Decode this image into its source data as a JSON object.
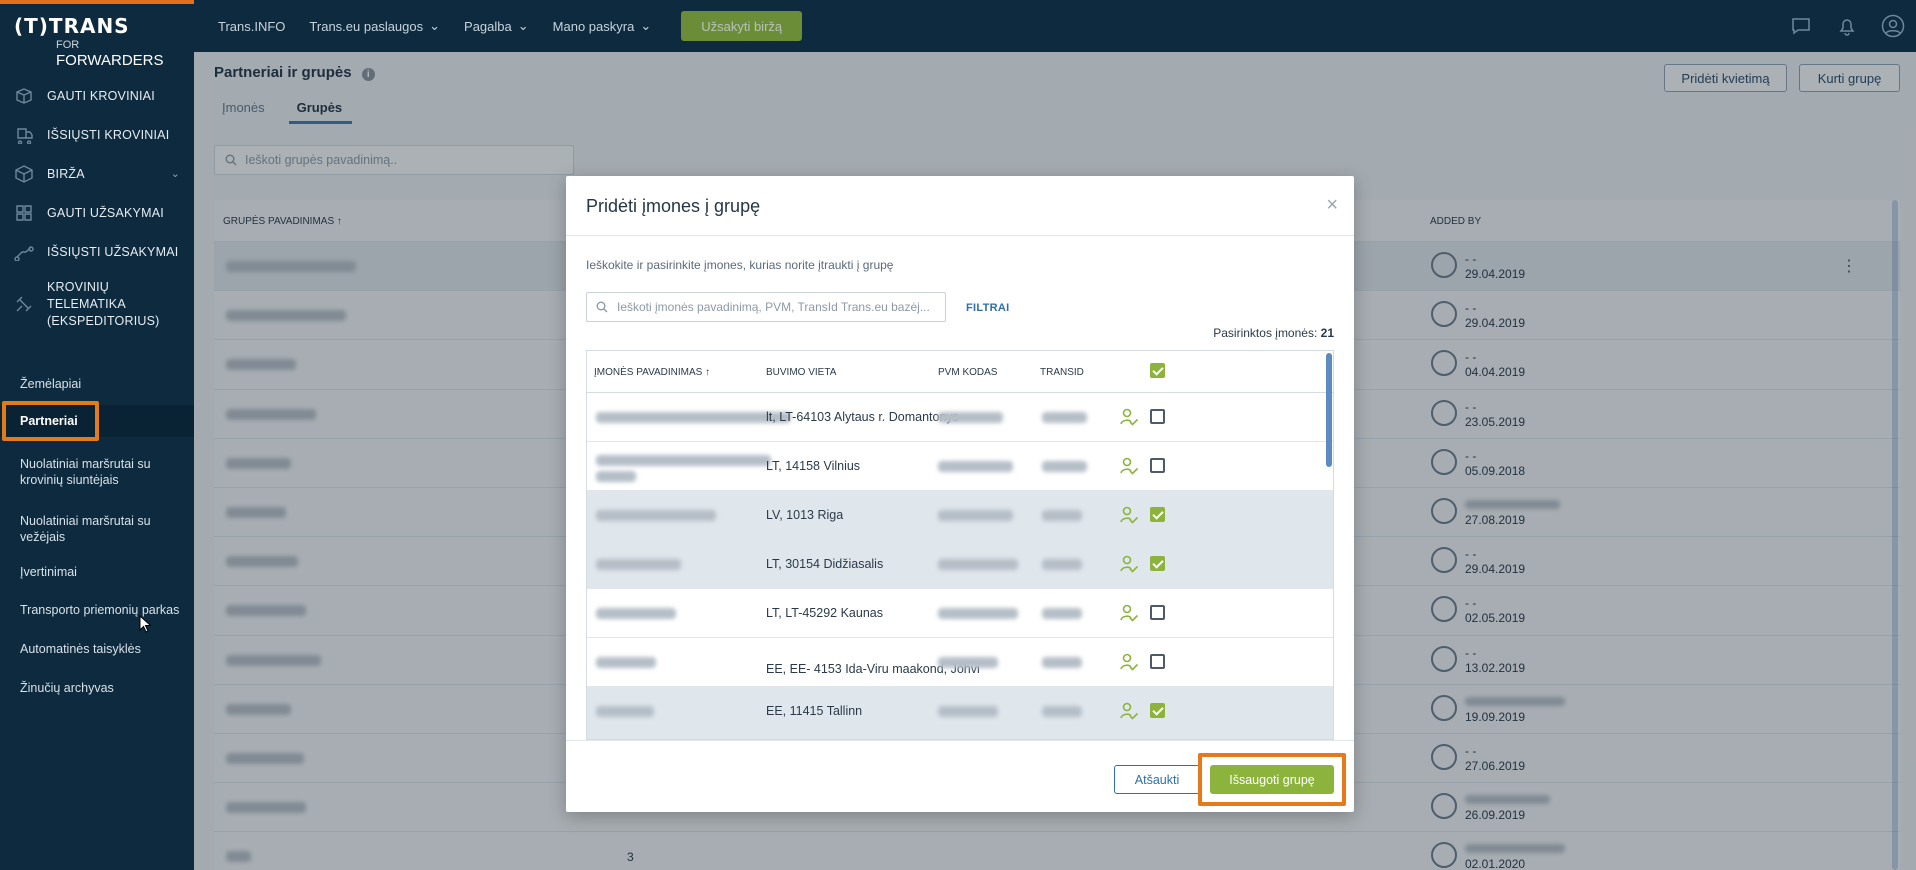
{
  "logo": {
    "line1": "(T)TRANS",
    "line2_small": "FOR",
    "line2": "FORWARDERS"
  },
  "sidebar": {
    "nav": [
      {
        "label": "GAUTI KROVINIAI",
        "icon": "box-icon"
      },
      {
        "label": "IŠSIŲSTI KROVINIAI",
        "icon": "box-send-icon"
      },
      {
        "label": "BIRŽA",
        "icon": "cube-icon",
        "expandable": true
      },
      {
        "label": "GAUTI UŽSAKYMAI",
        "icon": "grid-icon"
      },
      {
        "label": "IŠSIŲSTI UŽSAKYMAI",
        "icon": "link-icon"
      },
      {
        "label": "KROVINIŲ TELEMATIKA (EKSPEDITORIUS)",
        "icon": "satellite-icon"
      }
    ],
    "sub": [
      {
        "label": "Žemėlapiai"
      },
      {
        "label": "Partneriai",
        "active": true
      },
      {
        "label": "Nuolatiniai maršrutai su krovinių siuntėjais"
      },
      {
        "label": "Nuolatiniai maršrutai su vežėjais"
      },
      {
        "label": "Įvertinimai"
      },
      {
        "label": "Transporto priemonių parkas"
      },
      {
        "label": "Automatinės taisyklės"
      },
      {
        "label": "Žinučių archyvas"
      }
    ]
  },
  "topbar": {
    "items": [
      "Trans.INFO",
      "Trans.eu paslaugos",
      "Pagalba",
      "Mano paskyra"
    ],
    "cta": "Užsakyti biržą"
  },
  "page": {
    "title": "Partneriai ir grupės",
    "tabs": [
      "Įmonės",
      "Grupės"
    ],
    "active_tab": "Grupės",
    "btn_invite": "Pridėti kvietimą",
    "btn_create": "Kurti grupę",
    "search_placeholder": "Ieškoti grupės pavadinimą..",
    "table": {
      "col_name": "GRUPĖS PAVADINIMAS ↑",
      "col_added": "ADDED BY",
      "rows": [
        {
          "added": "- -",
          "date": "29.04.2019"
        },
        {
          "added": "- -",
          "date": "29.04.2019"
        },
        {
          "added": "- -",
          "date": "04.04.2019"
        },
        {
          "added": "- -",
          "date": "23.05.2019"
        },
        {
          "added": "- -",
          "date": "05.09.2018"
        },
        {
          "added": "",
          "date": "27.08.2019"
        },
        {
          "added": "- -",
          "date": "29.04.2019"
        },
        {
          "added": "- -",
          "date": "02.05.2019"
        },
        {
          "added": "- -",
          "date": "13.02.2019"
        },
        {
          "added": "",
          "date": "19.09.2019"
        },
        {
          "added": "- -",
          "date": "27.06.2019"
        },
        {
          "added": "",
          "date": "26.09.2019"
        },
        {
          "added": "",
          "date": "02.01.2020",
          "count": "3"
        }
      ]
    }
  },
  "modal": {
    "title": "Pridėti įmones į grupę",
    "desc": "Ieškokite ir pasirinkite įmones, kurias norite įtraukti į grupę",
    "search_placeholder": "Ieškoti įmonės pavadinimą, PVM, TransId Trans.eu bazėj...",
    "filters": "FILTRAI",
    "selected_label": "Pasirinktos įmonės:",
    "selected_count": "21",
    "columns": {
      "name": "ĮMONĖS PAVADINIMAS ↑",
      "location": "BUVIMO VIETA",
      "vat": "PVM KODAS",
      "transid": "TRANSID"
    },
    "rows": [
      {
        "location": "lt, LT-64103 Alytaus r. Domantonys",
        "checked": false
      },
      {
        "location": "LT, 14158 Vilnius",
        "checked": false
      },
      {
        "location": "LV, 1013 Riga",
        "checked": true
      },
      {
        "location": "LT, 30154 Didžiasalis",
        "checked": true
      },
      {
        "location": "LT, LT-45292 Kaunas",
        "checked": false
      },
      {
        "location": "EE, EE- 4153 Ida-Viru maakond, Jõhvi",
        "checked": false
      },
      {
        "location": "EE, 11415 Tallinn",
        "checked": true
      }
    ],
    "cancel": "Atšaukti",
    "save": "Išsaugoti grupę"
  }
}
